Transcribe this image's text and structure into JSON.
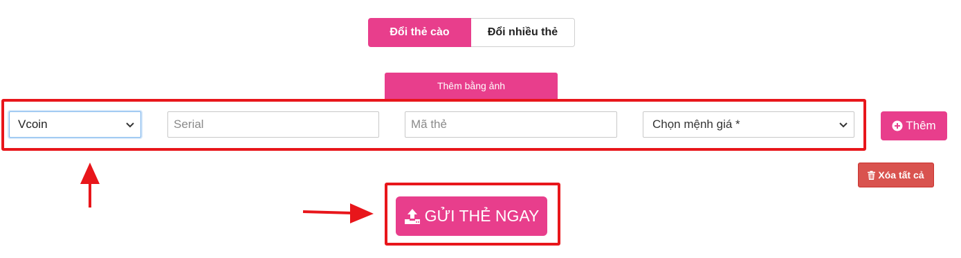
{
  "tabs": {
    "single_label": "Đổi thẻ cào",
    "multi_label": "Đổi nhiều thẻ"
  },
  "image_add": {
    "label": "Thêm bằng ảnh"
  },
  "form": {
    "card_type_value": "Vcoin",
    "serial_placeholder": "Serial",
    "code_placeholder": "Mã thẻ",
    "amount_placeholder": "Chọn mệnh giá *"
  },
  "actions": {
    "add_label": "Thêm",
    "clear_label": "Xóa tất cả",
    "send_label": "GỬI THẺ NGAY"
  },
  "colors": {
    "accent": "#e83e8c",
    "danger": "#d9534f",
    "annotation": "#e8161b"
  },
  "icons": {
    "add": "plus-circle-icon",
    "clear": "trash-icon",
    "send": "upload-icon",
    "select": "chevron-down-icon"
  }
}
